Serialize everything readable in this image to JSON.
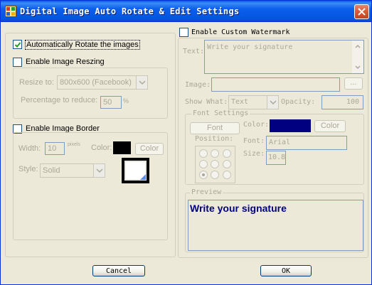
{
  "window": {
    "title": "Digital Image Auto Rotate & Edit Settings"
  },
  "left": {
    "auto_rotate": {
      "label": "Automatically Rotate the images",
      "checked": true
    },
    "resize": {
      "label": "Enable Image Reszing",
      "checked": false,
      "resize_to_label": "Resize to:",
      "resize_to_value": "800x600 (Facebook)",
      "percentage_label": "Percentage to reduce:",
      "percentage_value": "50",
      "percentage_unit": "%"
    },
    "border": {
      "label": "Enable Image Border",
      "checked": false,
      "width_label": "Width:",
      "width_value": "10",
      "width_unit": "pixels",
      "color_label": "Color:",
      "color_value": "#000000",
      "color_button": "Color",
      "style_label": "Style:",
      "style_value": "Solid"
    }
  },
  "right": {
    "watermark": {
      "label": "Enable Custom Watermark",
      "checked": false,
      "text_label": "Text:",
      "text_placeholder": "Write your signature",
      "image_label": "Image:",
      "browse_button": "...",
      "show_what_label": "Show What:",
      "show_what_value": "Text",
      "opacity_label": "Opacity:",
      "opacity_value": "100"
    },
    "font_settings": {
      "title": "Font Settings",
      "font_button": "Font",
      "color_label": "Color:",
      "color_value": "#000080",
      "color_button": "Color",
      "position_label": "Position:",
      "font_label": "Font:",
      "font_value": "Arial",
      "size_label": "Size:",
      "size_value": "10.8",
      "position_selected": "bottom-left"
    },
    "preview": {
      "title": "Preview",
      "text": "Write your signature",
      "text_color": "#000080"
    }
  },
  "buttons": {
    "cancel": "Cancel",
    "ok": "OK"
  }
}
